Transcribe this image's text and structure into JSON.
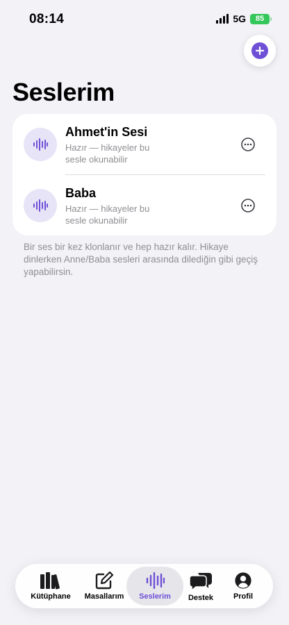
{
  "status_bar": {
    "time": "08:14",
    "network": "5G",
    "battery": "85"
  },
  "header": {
    "title": "Seslerim",
    "add_icon": "plus-circle-icon"
  },
  "voices": [
    {
      "name": "Ahmet'in Sesi",
      "status": "Hazır — hikayeler bu sesle okunabilir"
    },
    {
      "name": "Baba",
      "status": "Hazır — hikayeler bu sesle okunabilir"
    }
  ],
  "info": "Bir ses bir kez klonlanır ve hep hazır kalır. Hikaye dinlerken Anne/Baba sesleri arasında dilediğin gibi geçiş yapabilirsin.",
  "tabs": [
    {
      "label": "Kütüphane",
      "icon": "library-books-icon"
    },
    {
      "label": "Masallarım",
      "icon": "edit-square-icon"
    },
    {
      "label": "Seslerim",
      "icon": "waveform-icon",
      "active": true
    },
    {
      "label": "Destek",
      "icon": "chat-bubbles-icon"
    },
    {
      "label": "Profil",
      "icon": "person-circle-icon"
    }
  ],
  "colors": {
    "accent": "#6e4fd6",
    "battery": "#34c759",
    "background": "#f2f2f7"
  }
}
